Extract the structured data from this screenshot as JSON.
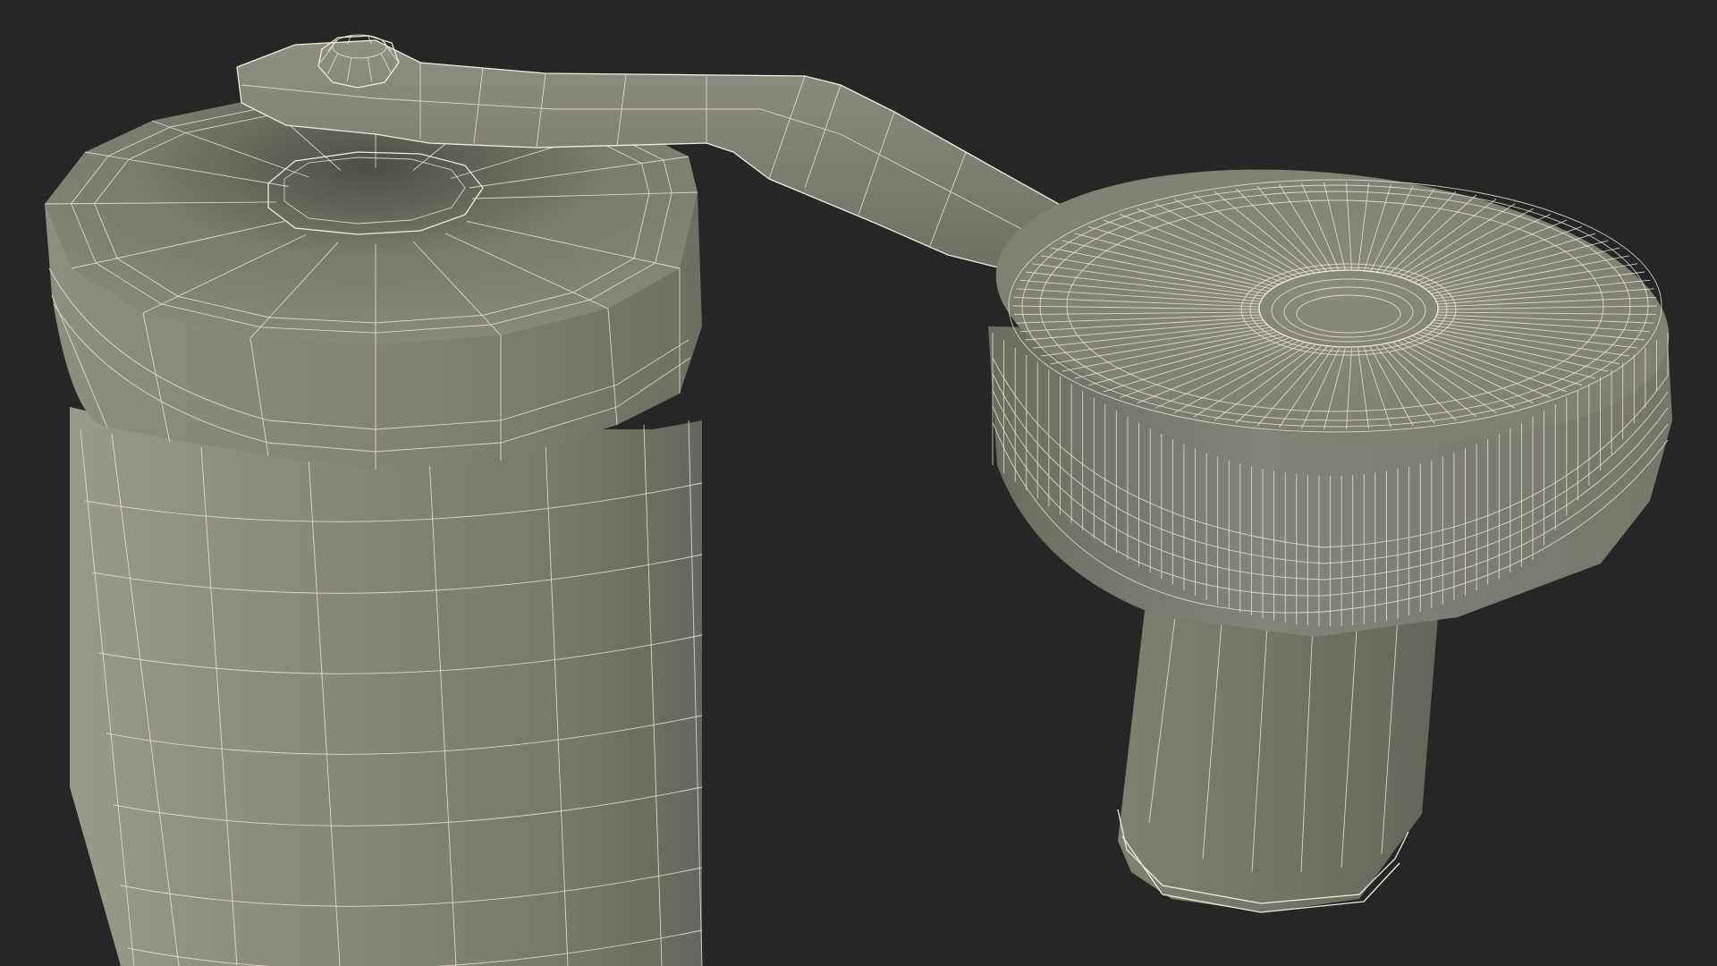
{
  "scene": {
    "description_label": "",
    "colors": {
      "background": "#262626",
      "surface_light": "#8b8b7d",
      "surface_mid": "#77776a",
      "surface_dark": "#5b5b51",
      "wireframe": "#e9e8da"
    },
    "objects": [
      {
        "name": "grinder-body"
      },
      {
        "name": "grinder-lid"
      },
      {
        "name": "crank-arm"
      },
      {
        "name": "knob-cap"
      },
      {
        "name": "knob-stem"
      }
    ]
  }
}
